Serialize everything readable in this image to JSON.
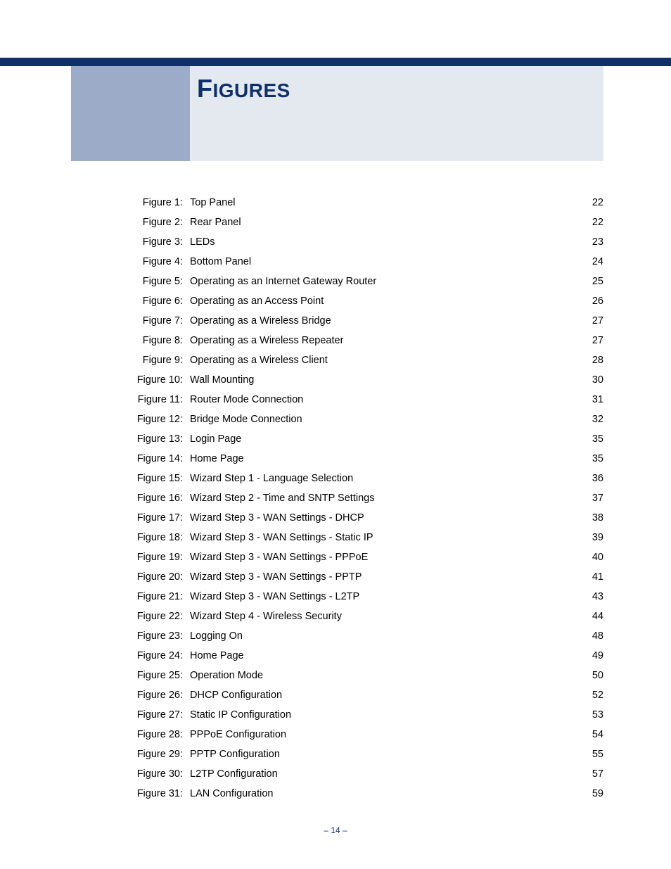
{
  "title": {
    "cap": "F",
    "rest": "IGURES"
  },
  "footer": "–  14  –",
  "entries": [
    {
      "label": "Figure 1:",
      "text": "Top Panel",
      "page": "22"
    },
    {
      "label": "Figure 2:",
      "text": "Rear Panel",
      "page": "22"
    },
    {
      "label": "Figure 3:",
      "text": "LEDs",
      "page": "23"
    },
    {
      "label": "Figure 4:",
      "text": "Bottom Panel",
      "page": "24"
    },
    {
      "label": "Figure 5:",
      "text": "Operating as an Internet Gateway Router",
      "page": "25"
    },
    {
      "label": "Figure 6:",
      "text": "Operating as an Access Point",
      "page": "26"
    },
    {
      "label": "Figure 7:",
      "text": "Operating as a Wireless Bridge",
      "page": "27"
    },
    {
      "label": "Figure 8:",
      "text": "Operating as a Wireless Repeater",
      "page": "27"
    },
    {
      "label": "Figure 9:",
      "text": "Operating as a Wireless Client",
      "page": "28"
    },
    {
      "label": "Figure 10:",
      "text": "Wall Mounting",
      "page": "30"
    },
    {
      "label": "Figure 11:",
      "text": "Router Mode Connection",
      "page": "31"
    },
    {
      "label": "Figure 12:",
      "text": "Bridge Mode Connection",
      "page": "32"
    },
    {
      "label": "Figure 13:",
      "text": "Login Page",
      "page": "35"
    },
    {
      "label": "Figure 14:",
      "text": "Home Page",
      "page": "35"
    },
    {
      "label": "Figure 15:",
      "text": "Wizard Step 1 - Language Selection",
      "page": "36"
    },
    {
      "label": "Figure 16:",
      "text": "Wizard Step 2 - Time and SNTP Settings",
      "page": "37"
    },
    {
      "label": "Figure 17:",
      "text": "Wizard Step 3 - WAN Settings - DHCP",
      "page": "38"
    },
    {
      "label": "Figure 18:",
      "text": "Wizard Step 3 - WAN Settings - Static IP",
      "page": "39"
    },
    {
      "label": "Figure 19:",
      "text": "Wizard Step 3 - WAN Settings - PPPoE",
      "page": "40"
    },
    {
      "label": "Figure 20:",
      "text": "Wizard Step 3 - WAN Settings - PPTP",
      "page": "41"
    },
    {
      "label": "Figure 21:",
      "text": "Wizard Step 3 - WAN Settings - L2TP",
      "page": "43"
    },
    {
      "label": "Figure 22:",
      "text": "Wizard Step 4 - Wireless Security",
      "page": "44"
    },
    {
      "label": "Figure 23:",
      "text": "Logging On",
      "page": "48"
    },
    {
      "label": "Figure 24:",
      "text": "Home Page",
      "page": "49"
    },
    {
      "label": "Figure 25:",
      "text": "Operation Mode",
      "page": "50"
    },
    {
      "label": "Figure 26:",
      "text": "DHCP Configuration",
      "page": "52"
    },
    {
      "label": "Figure 27:",
      "text": "Static IP Configuration",
      "page": "53"
    },
    {
      "label": "Figure 28:",
      "text": "PPPoE Configuration",
      "page": "54"
    },
    {
      "label": "Figure 29:",
      "text": "PPTP Configuration",
      "page": "55"
    },
    {
      "label": "Figure 30:",
      "text": "L2TP Configuration",
      "page": "57"
    },
    {
      "label": "Figure 31:",
      "text": "LAN Configuration",
      "page": "59"
    }
  ]
}
